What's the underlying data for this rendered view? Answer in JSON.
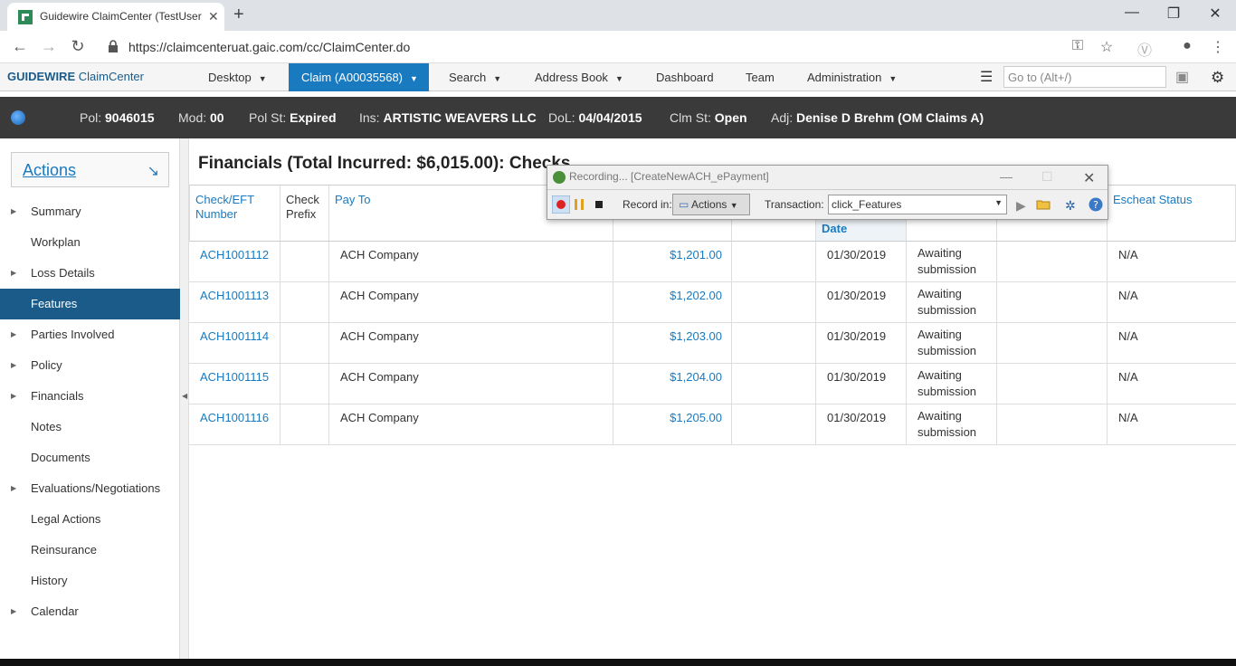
{
  "browser": {
    "tab_title": "Guidewire ClaimCenter (TestUser",
    "url": "https://claimcenteruat.gaic.com/cc/ClaimCenter.do"
  },
  "appnav": {
    "logo_brand": "GUIDEWIRE",
    "logo_product": "ClaimCenter",
    "items": [
      {
        "label": "Desktop"
      },
      {
        "label": "Claim (A00035568)"
      },
      {
        "label": "Search"
      },
      {
        "label": "Address Book"
      },
      {
        "label": "Dashboard"
      },
      {
        "label": "Team"
      },
      {
        "label": "Administration"
      }
    ],
    "goto_placeholder": "Go to (Alt+/)"
  },
  "infobar": {
    "pol_label": "Pol:",
    "pol": "9046015",
    "mod_label": "Mod:",
    "mod": "00",
    "polst_label": "Pol St:",
    "polst": "Expired",
    "ins_label": "Ins:",
    "ins": "ARTISTIC WEAVERS LLC",
    "dol_label": "DoL:",
    "dol": "04/04/2015",
    "clmst_label": "Clm St:",
    "clmst": "Open",
    "adj_label": "Adj:",
    "adj": "Denise D Brehm (OM Claims A)"
  },
  "sidebar": {
    "actions_label": "Actions",
    "items": [
      {
        "label": "Summary"
      },
      {
        "label": "Workplan"
      },
      {
        "label": "Loss Details"
      },
      {
        "label": "Features"
      },
      {
        "label": "Parties Involved"
      },
      {
        "label": "Policy"
      },
      {
        "label": "Financials"
      },
      {
        "label": "Notes"
      },
      {
        "label": "Documents"
      },
      {
        "label": "Evaluations/Negotiations"
      },
      {
        "label": "Legal Actions"
      },
      {
        "label": "Reinsurance"
      },
      {
        "label": "History"
      },
      {
        "label": "Calendar"
      }
    ]
  },
  "main": {
    "title": "Financials (Total Incurred: $6,015.00): Checks",
    "headers": {
      "check_number": "Check/EFT Number",
      "check_prefix": "Check Prefix",
      "pay_to": "Pay To",
      "date": "Date",
      "escheat": "Escheat Status"
    },
    "rows": [
      {
        "number": "ACH1001112",
        "pay_to": "ACH Company",
        "amount": "$1,201.00",
        "date": "01/30/2019",
        "status": "Awaiting submission",
        "escheat": "N/A"
      },
      {
        "number": "ACH1001113",
        "pay_to": "ACH Company",
        "amount": "$1,202.00",
        "date": "01/30/2019",
        "status": "Awaiting submission",
        "escheat": "N/A"
      },
      {
        "number": "ACH1001114",
        "pay_to": "ACH Company",
        "amount": "$1,203.00",
        "date": "01/30/2019",
        "status": "Awaiting submission",
        "escheat": "N/A"
      },
      {
        "number": "ACH1001115",
        "pay_to": "ACH Company",
        "amount": "$1,204.00",
        "date": "01/30/2019",
        "status": "Awaiting submission",
        "escheat": "N/A"
      },
      {
        "number": "ACH1001116",
        "pay_to": "ACH Company",
        "amount": "$1,205.00",
        "date": "01/30/2019",
        "status": "Awaiting submission",
        "escheat": "N/A"
      }
    ]
  },
  "recorder": {
    "title": "Recording... [CreateNewACH_ePayment]",
    "record_in_label": "Record in:",
    "record_in_value": "Actions",
    "transaction_label": "Transaction:",
    "transaction_value": "click_Features"
  }
}
